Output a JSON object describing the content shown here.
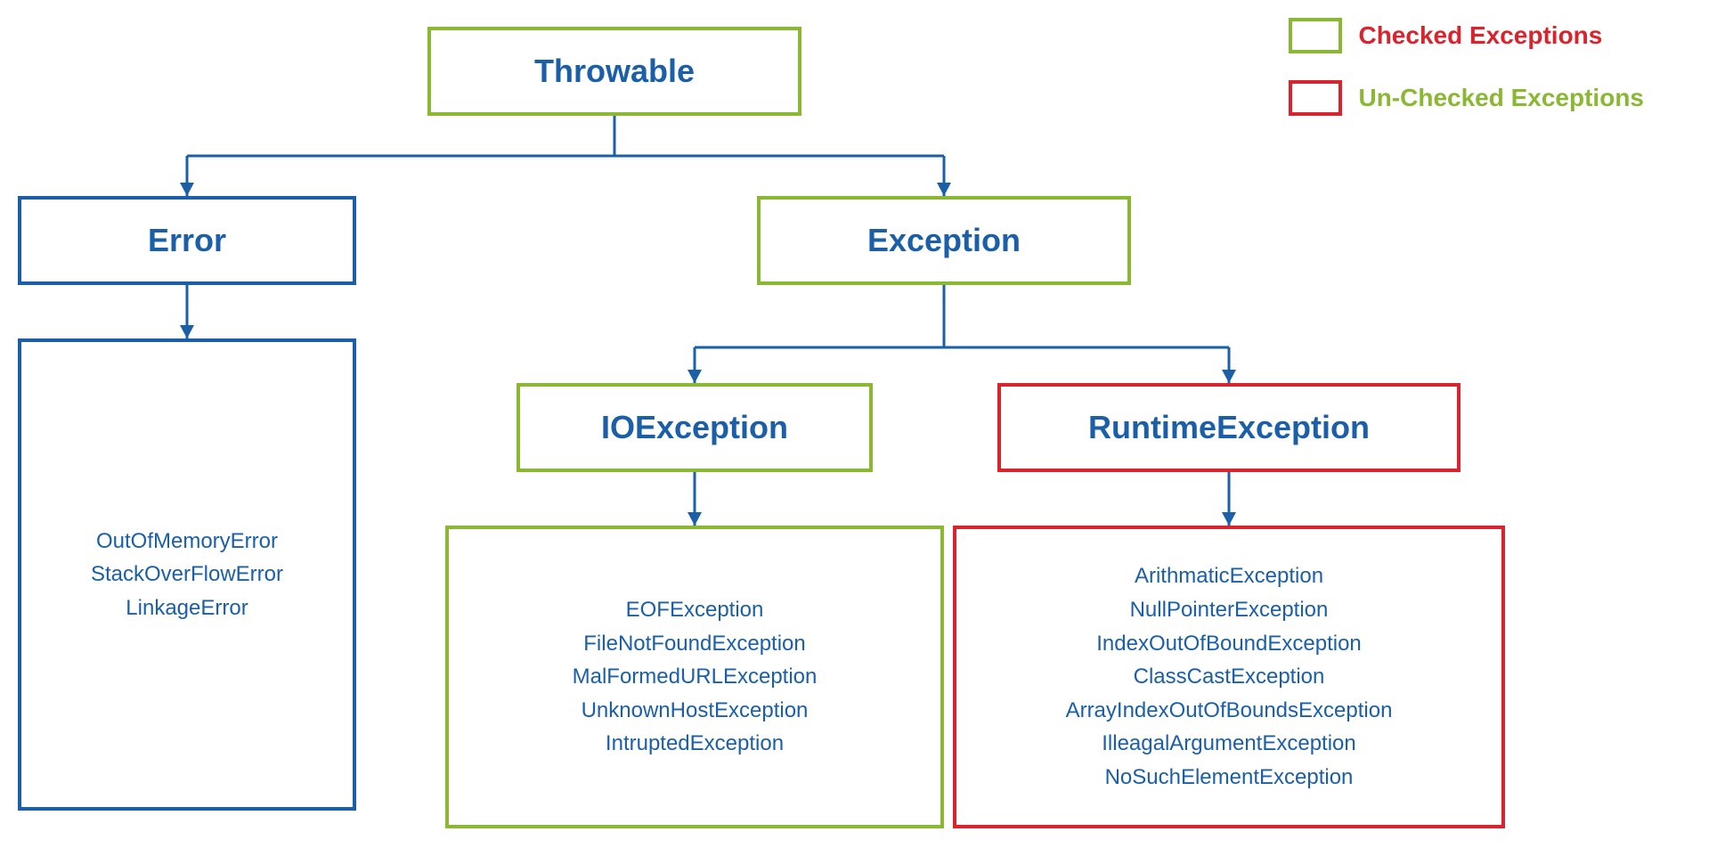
{
  "legend": {
    "checked_label": "Checked Exceptions",
    "unchecked_label": "Un-Checked Exceptions"
  },
  "nodes": {
    "throwable": "Throwable",
    "error": "Error",
    "exception": "Exception",
    "ioexception": "IOException",
    "runtimeexception": "RuntimeException"
  },
  "lists": {
    "error_items": [
      "OutOfMemoryError",
      "StackOverFlowError",
      "LinkageError"
    ],
    "ioexception_items": [
      "EOFException",
      "FileNotFoundException",
      "MalFormedURLException",
      "UnknownHostException",
      "IntruptedException"
    ],
    "runtime_items": [
      "ArithmaticException",
      "NullPointerException",
      "IndexOutOfBoundException",
      "ClassCastException",
      "ArrayIndexOutOfBoundsException",
      "IlleagalArgumentException",
      "NoSuchElementException"
    ]
  },
  "colors": {
    "blue": "#1a5fa8",
    "green": "#8ab833",
    "red": "#d9232d"
  }
}
